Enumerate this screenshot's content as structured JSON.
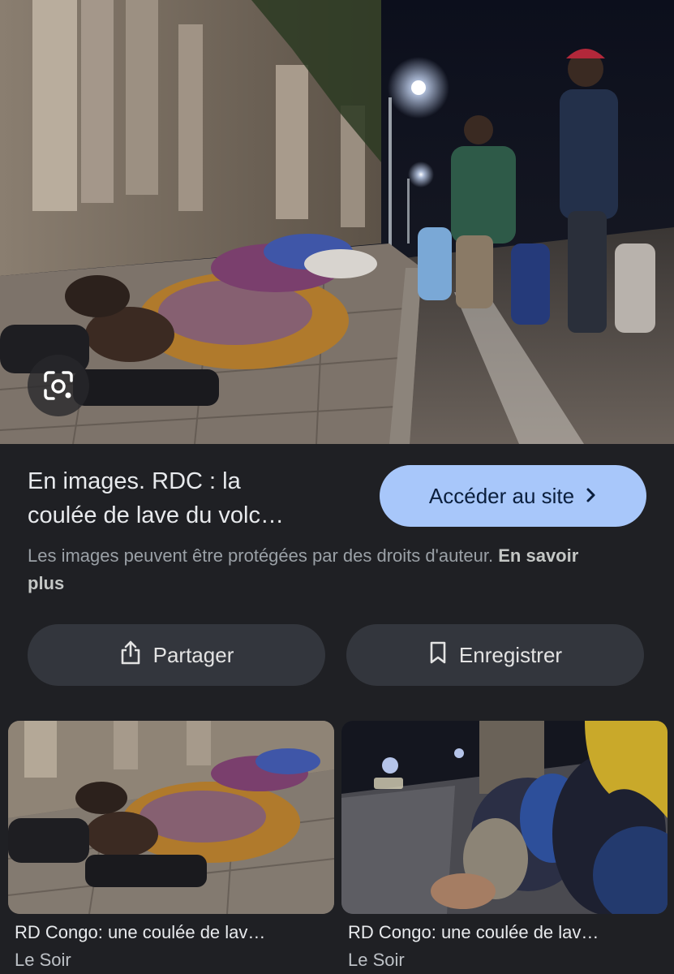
{
  "result": {
    "title": "En images. RDC : la\ncoulée de lave du volc…",
    "visit_label": "Accéder au site",
    "copyright_notice": "Les images peuvent être protégées par des droits d'auteur.",
    "learn_more": "En savoir plus"
  },
  "actions": {
    "share_label": "Partager",
    "save_label": "Enregistrer"
  },
  "related": [
    {
      "title": "RD Congo: une coulée de lav…",
      "source": "Le Soir"
    },
    {
      "title": "RD Congo: une coulée de lav…",
      "source": "Le Soir"
    }
  ],
  "icons": {
    "lens": "google-lens-icon",
    "visit": "chevron-right-icon",
    "share": "share-icon",
    "save": "bookmark-icon"
  },
  "colors": {
    "background": "#1f2024",
    "visit_button": "#a8c7fa",
    "action_button": "#33363d"
  }
}
